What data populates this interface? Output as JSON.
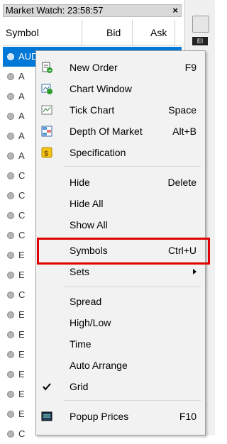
{
  "window": {
    "title": "Market Watch: 23:58:57",
    "close_glyph": "×",
    "columns": [
      "Symbol",
      "Bid",
      "Ask"
    ]
  },
  "rows": [
    {
      "prefix": "AUDC",
      "selected": true
    },
    {
      "prefix": "A"
    },
    {
      "prefix": "A"
    },
    {
      "prefix": "A"
    },
    {
      "prefix": "A"
    },
    {
      "prefix": "A"
    },
    {
      "prefix": "C"
    },
    {
      "prefix": "C"
    },
    {
      "prefix": "C"
    },
    {
      "prefix": "C"
    },
    {
      "prefix": "E"
    },
    {
      "prefix": "E"
    },
    {
      "prefix": "C"
    },
    {
      "prefix": "E"
    },
    {
      "prefix": "E"
    },
    {
      "prefix": "E"
    },
    {
      "prefix": "E"
    },
    {
      "prefix": "E"
    },
    {
      "prefix": "E"
    },
    {
      "prefix": "C"
    }
  ],
  "side": {
    "tab_label": "EI"
  },
  "menu": {
    "items": [
      {
        "label": "New Order",
        "shortcut": "F9",
        "icon": "new-order-icon"
      },
      {
        "label": "Chart Window",
        "shortcut": "",
        "icon": "chart-window-icon"
      },
      {
        "label": "Tick Chart",
        "shortcut": "Space",
        "icon": "tick-chart-icon"
      },
      {
        "label": "Depth Of Market",
        "shortcut": "Alt+B",
        "icon": "depth-of-market-icon"
      },
      {
        "label": "Specification",
        "shortcut": "",
        "icon": "specification-icon"
      },
      {
        "label": "Hide",
        "shortcut": "Delete"
      },
      {
        "label": "Hide All",
        "shortcut": ""
      },
      {
        "label": "Show All",
        "shortcut": ""
      },
      {
        "label": "Symbols",
        "shortcut": "Ctrl+U",
        "highlighted": true
      },
      {
        "label": "Sets",
        "shortcut": "",
        "submenu": true
      },
      {
        "label": "Spread",
        "shortcut": ""
      },
      {
        "label": "High/Low",
        "shortcut": ""
      },
      {
        "label": "Time",
        "shortcut": ""
      },
      {
        "label": "Auto Arrange",
        "shortcut": ""
      },
      {
        "label": "Grid",
        "shortcut": "",
        "checked": true
      },
      {
        "label": "Popup Prices",
        "shortcut": "F10",
        "icon": "popup-prices-icon"
      }
    ]
  },
  "colors": {
    "selection": "#0078d7",
    "highlight_box": "#e00000"
  }
}
